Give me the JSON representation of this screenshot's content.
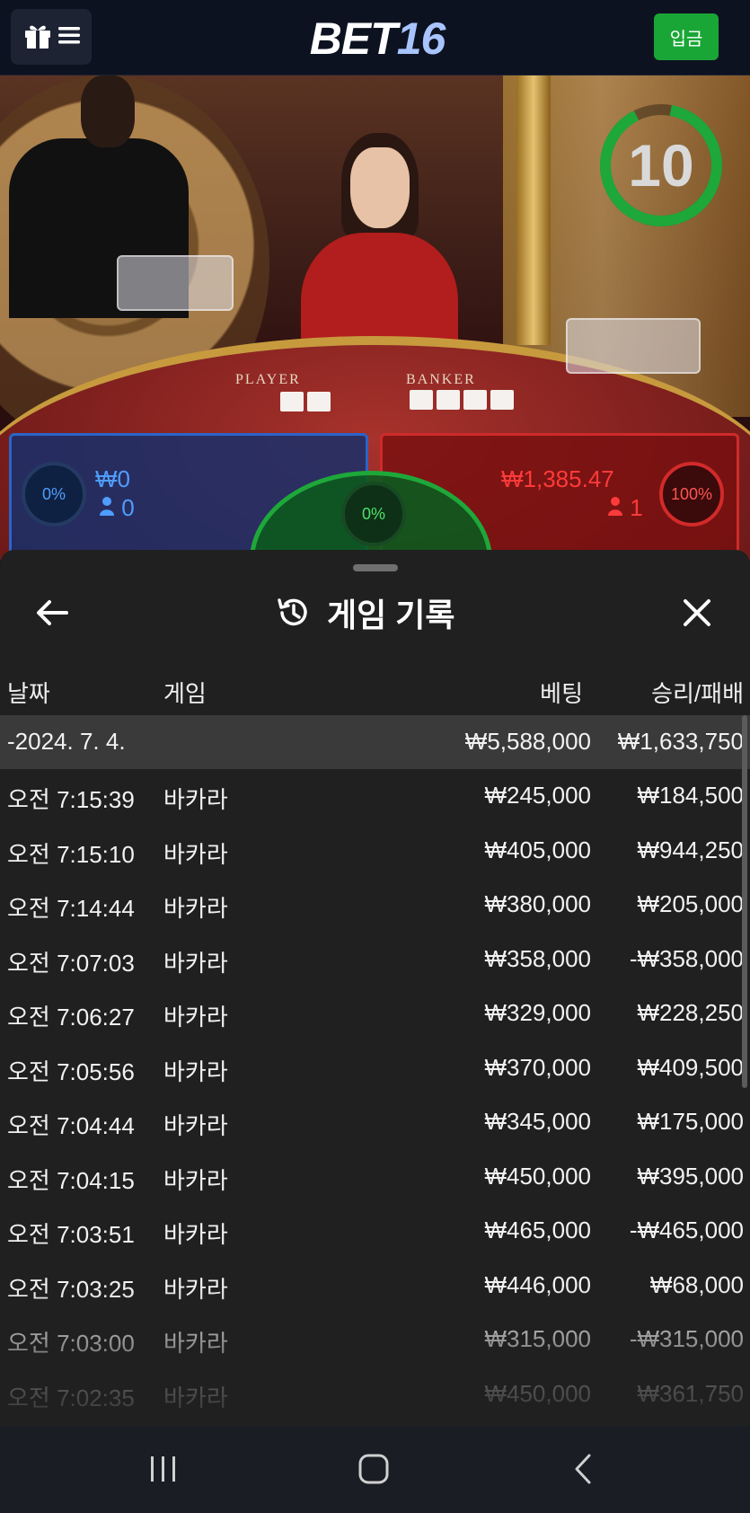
{
  "header": {
    "logo_white": "BET",
    "logo_blue": "16",
    "deposit_label": "입금",
    "menu_icon": "gift-menu-icon"
  },
  "game": {
    "timer": "10",
    "table_player_label": "PLAYER",
    "table_banker_label": "BANKER",
    "player": {
      "percent": "0%",
      "amount": "₩0",
      "count": "0"
    },
    "tie": {
      "percent": "0%"
    },
    "banker": {
      "percent": "100%",
      "amount": "₩1,385.47",
      "count": "1"
    },
    "colors": {
      "player": "#2b64c8",
      "banker": "#cf2a2a",
      "tie": "#1ea83a",
      "timer": "#1ea83a"
    }
  },
  "history": {
    "title": "게임 기록",
    "title_icon": "history-icon",
    "back_icon": "back-arrow-icon",
    "close_icon": "close-icon",
    "columns": {
      "date": "날짜",
      "game": "게임",
      "bet": "베팅",
      "result": "승리/패배"
    },
    "date_row": {
      "date": "-2024. 7. 4.",
      "bet": "₩5,588,000",
      "result": "₩1,633,750"
    },
    "rows": [
      {
        "time": "오전 7:15:39",
        "game": "바카라",
        "bet": "₩245,000",
        "result": "₩184,500"
      },
      {
        "time": "오전 7:15:10",
        "game": "바카라",
        "bet": "₩405,000",
        "result": "₩944,250"
      },
      {
        "time": "오전 7:14:44",
        "game": "바카라",
        "bet": "₩380,000",
        "result": "₩205,000"
      },
      {
        "time": "오전 7:07:03",
        "game": "바카라",
        "bet": "₩358,000",
        "result": "-₩358,000"
      },
      {
        "time": "오전 7:06:27",
        "game": "바카라",
        "bet": "₩329,000",
        "result": "₩228,250"
      },
      {
        "time": "오전 7:05:56",
        "game": "바카라",
        "bet": "₩370,000",
        "result": "₩409,500"
      },
      {
        "time": "오전 7:04:44",
        "game": "바카라",
        "bet": "₩345,000",
        "result": "₩175,000"
      },
      {
        "time": "오전 7:04:15",
        "game": "바카라",
        "bet": "₩450,000",
        "result": "₩395,000"
      },
      {
        "time": "오전 7:03:51",
        "game": "바카라",
        "bet": "₩465,000",
        "result": "-₩465,000"
      },
      {
        "time": "오전 7:03:25",
        "game": "바카라",
        "bet": "₩446,000",
        "result": "₩68,000"
      },
      {
        "time": "오전 7:03:00",
        "game": "바카라",
        "bet": "₩315,000",
        "result": "-₩315,000"
      },
      {
        "time": "오전 7:02:35",
        "game": "바카라",
        "bet": "₩450,000",
        "result": "₩361,750"
      }
    ]
  },
  "navbar": {
    "recents_icon": "recents-icon",
    "home_icon": "home-icon",
    "back_icon": "back-icon"
  }
}
